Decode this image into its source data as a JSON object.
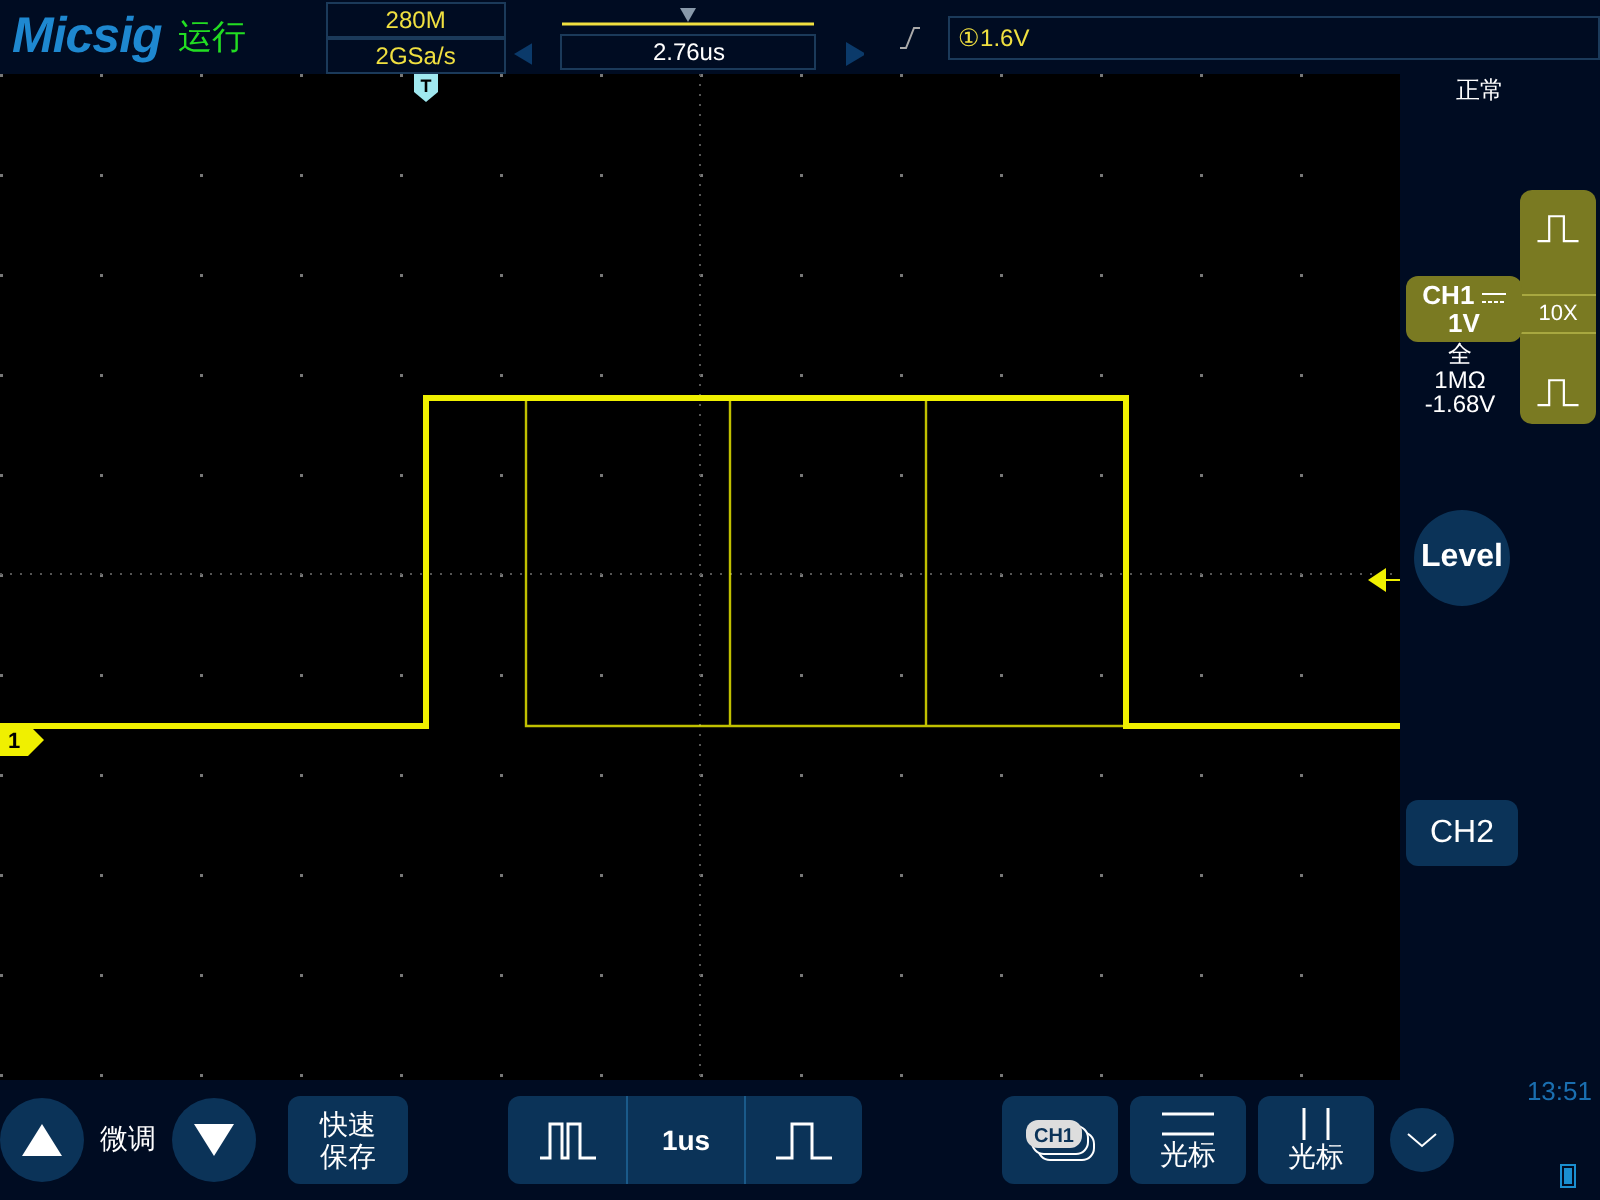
{
  "header": {
    "logo": "Micsig",
    "run_state": "运行",
    "memory_depth": "280M",
    "sample_rate": "2GSa/s",
    "trigger_position": "2.76us",
    "trigger_level": "①1.6V"
  },
  "scope": {
    "trigger_marker": "T",
    "channel_marker": "1"
  },
  "side_panel": {
    "trigger_mode": "正常",
    "channel": {
      "name": "CH1",
      "scale": "1V",
      "bandwidth": "全",
      "impedance": "1MΩ",
      "offset": "-1.68V"
    },
    "probe": "10X",
    "level_button": "Level",
    "ch2_button": "CH2"
  },
  "bottom_bar": {
    "fine_label": "微调",
    "quick_save": "快速保存",
    "timebase": "1us",
    "ch1_button": "CH1",
    "cursor_buttons": [
      {
        "kind": "horizontal",
        "label": "光标"
      },
      {
        "kind": "vertical",
        "label": "光标"
      }
    ],
    "time": "13:51"
  }
}
